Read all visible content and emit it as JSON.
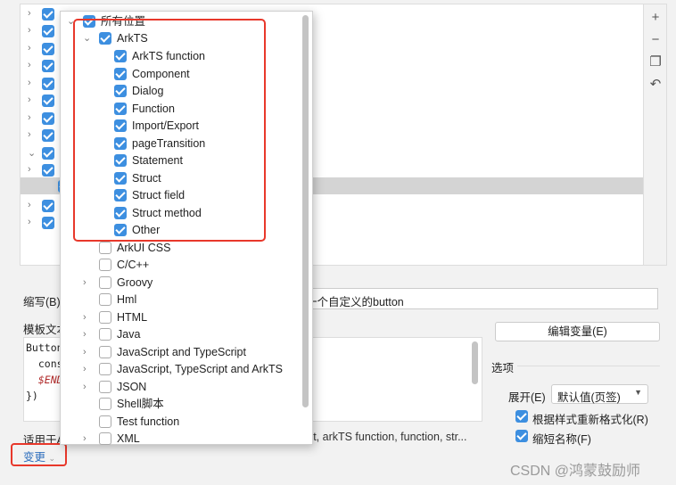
{
  "colors": {
    "accent": "#3d8fe0",
    "highlight": "#e8382b",
    "link": "#2f6fbd"
  },
  "tree_toolbar": [
    {
      "icon": "plus-dropdown-icon",
      "glyph": "+"
    },
    {
      "icon": "minus-icon",
      "glyph": "−"
    },
    {
      "icon": "copy-icon",
      "glyph": "❐"
    },
    {
      "icon": "undo-icon",
      "glyph": "↶"
    }
  ],
  "popup": {
    "root": "所有位置",
    "arkts": {
      "label": "ArkTS",
      "children": [
        "ArkTS function",
        "Component",
        "Dialog",
        "Function",
        "Import/Export",
        "pageTransition",
        "Statement",
        "Struct",
        "Struct field",
        "Struct method",
        "Other"
      ]
    },
    "others": [
      {
        "label": "ArkUI CSS",
        "expandable": false
      },
      {
        "label": "C/C++",
        "expandable": false
      },
      {
        "label": "Groovy",
        "expandable": true
      },
      {
        "label": "Hml",
        "expandable": false
      },
      {
        "label": "HTML",
        "expandable": true
      },
      {
        "label": "Java",
        "expandable": true
      },
      {
        "label": "JavaScript and TypeScript",
        "expandable": true
      },
      {
        "label": "JavaScript, TypeScript and ArkTS",
        "expandable": true
      },
      {
        "label": "JSON",
        "expandable": true
      },
      {
        "label": "Shell脚本",
        "expandable": false
      },
      {
        "label": "Test function",
        "expandable": false
      },
      {
        "label": "XML",
        "expandable": true
      }
    ]
  },
  "form": {
    "abbrev_label": "缩写(B)",
    "description_value": "一个自定义的button",
    "template_label": "模板文本",
    "code_lines": [
      "Button",
      "  cons",
      "  $END",
      "})"
    ],
    "edit_vars_button": "编辑变量(E)",
    "options_title": "选项",
    "expand_label": "展开(E)",
    "expand_value": "默认值(页签)",
    "reformat_label": "根据样式重新格式化(R)",
    "shorten_label": "缩短名称(F)",
    "applies_label": "适用于A",
    "applies_value": "uct, arkTS function, function, str...",
    "change_link": "变更"
  },
  "watermark": "CSDN @鸿蒙鼓励师"
}
